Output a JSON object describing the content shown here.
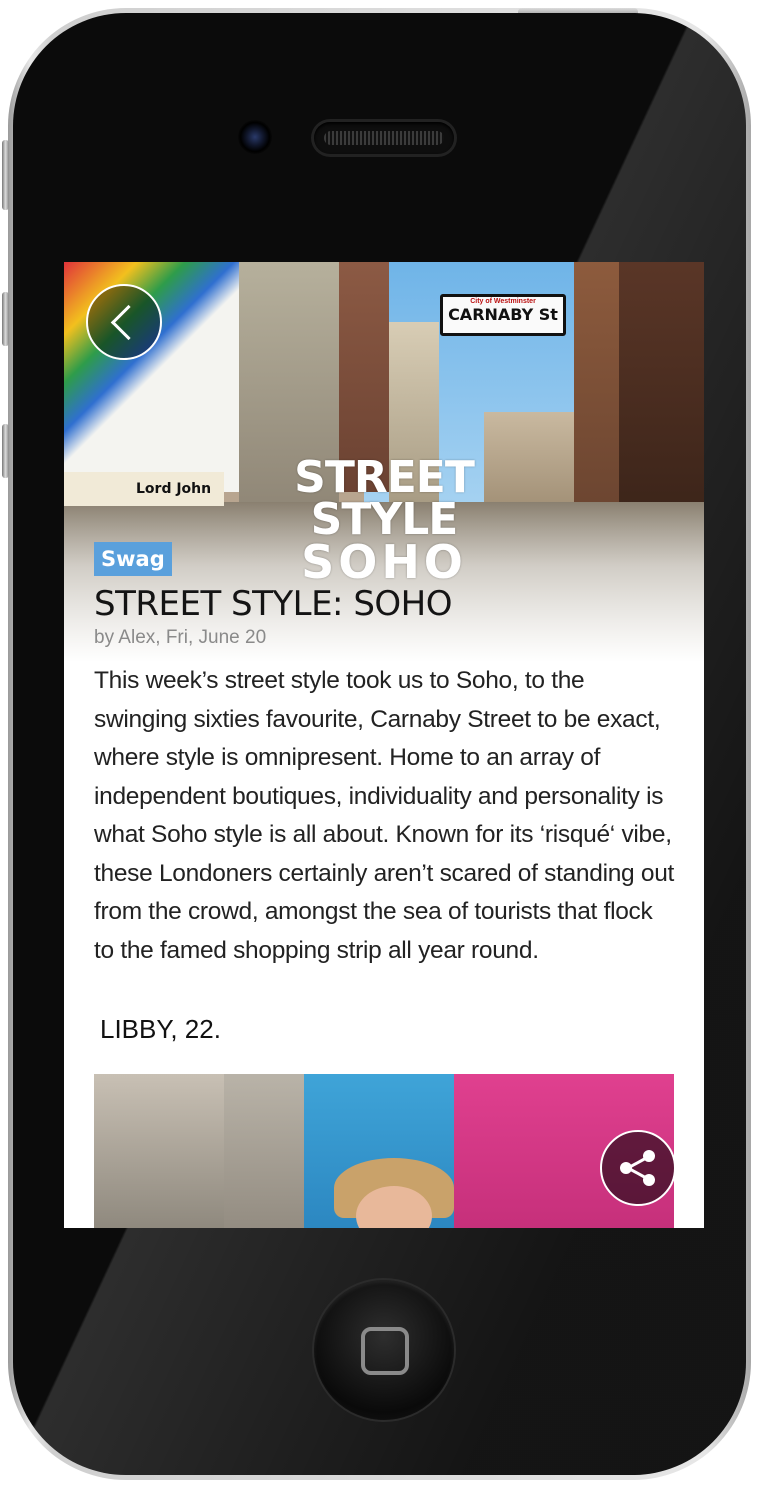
{
  "hero": {
    "banner_line1": "STREET STYLE",
    "banner_line2": "SOHO",
    "sign_small": "City of Westminster",
    "sign_main": "CARNABY St",
    "shop_sign": "Lord John"
  },
  "article": {
    "tag": "Swag",
    "title": "STREET STYLE: SOHO",
    "byline": "by Alex, Fri, June 20",
    "body_lines": [
      "This week’s street style took us to Soho, to the",
      "swinging sixties favourite, Carnaby Street to be exact,",
      "where style is omnipresent. Home to an array of",
      "independent boutiques, individuality and personality is",
      "what Soho style is all about. Known for its ‘risqué‘ vibe,",
      "these Londoners certainly aren’t scared of standing out",
      "from the crowd, amongst the sea of tourists that flock",
      "to the famed shopping strip all year round."
    ],
    "person_caption": "LIBBY, 22."
  },
  "colors": {
    "tag_bg": "#5aa0dc",
    "title_text": "#141414",
    "byline_text": "#8a8a8a"
  },
  "icons": [
    "back-chevron-icon",
    "share-icon",
    "home-button-icon"
  ]
}
